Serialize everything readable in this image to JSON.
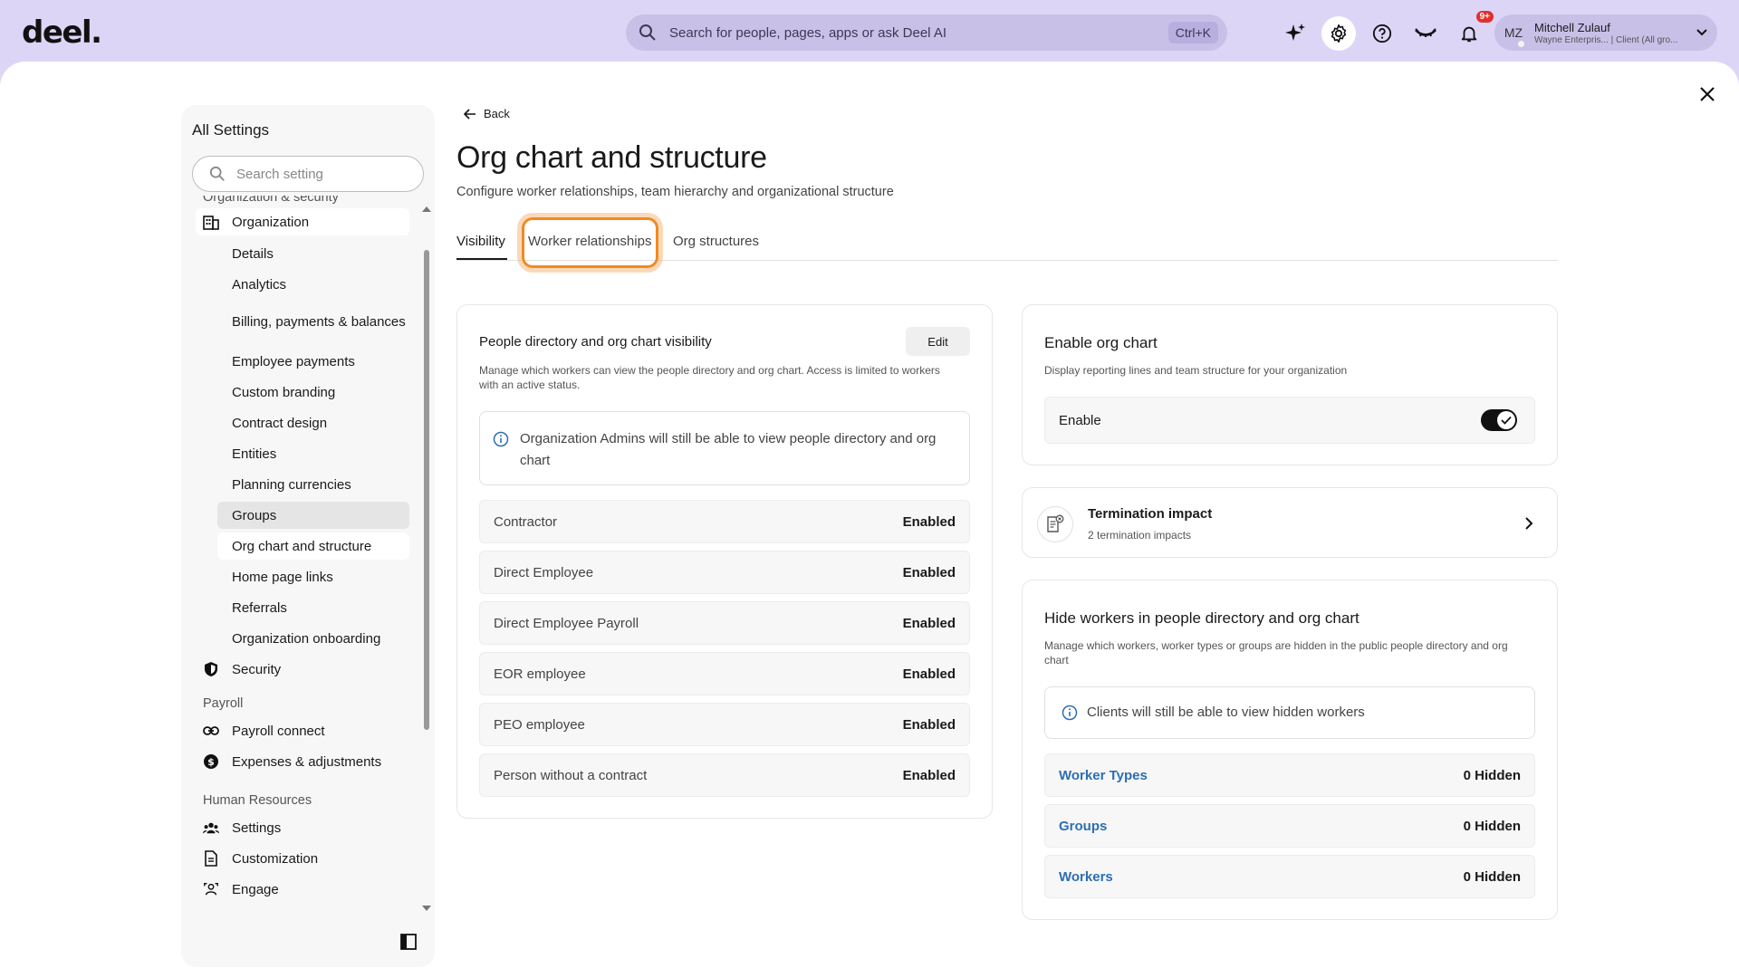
{
  "topbar": {
    "logo": "deel.",
    "search_placeholder": "Search for people, pages, apps or ask Deel AI",
    "search_shortcut": "Ctrl+K",
    "notifications_badge": "9+",
    "user": {
      "initials": "MZ",
      "name": "Mitchell Zulauf",
      "subtitle": "Wayne Enterpris... | Client (All gro..."
    }
  },
  "sidebar": {
    "title": "All Settings",
    "search_placeholder": "Search setting",
    "sections": {
      "org_security": "Organization & security",
      "payroll": "Payroll",
      "hr": "Human Resources"
    },
    "organization": "Organization",
    "org_items": [
      "Details",
      "Analytics",
      "Billing, payments & balances",
      "Employee payments",
      "Custom branding",
      "Contract design",
      "Entities",
      "Planning currencies",
      "Groups",
      "Org chart and structure",
      "Home page links",
      "Referrals",
      "Organization onboarding"
    ],
    "security": "Security",
    "payroll_items": [
      "Payroll connect",
      "Expenses & adjustments"
    ],
    "hr_items": [
      "Settings",
      "Customization",
      "Engage"
    ]
  },
  "content": {
    "back": "Back",
    "title": "Org chart and structure",
    "subtitle": "Configure worker relationships, team hierarchy and organizational structure",
    "tabs": [
      "Visibility",
      "Worker relationships",
      "Org structures"
    ],
    "visibility_card": {
      "title": "People directory and org chart visibility",
      "edit": "Edit",
      "desc": "Manage which workers can view the people directory and org chart. Access is limited to workers with an active status.",
      "info": "Organization Admins will still be able to view people directory and org chart",
      "rows": [
        {
          "label": "Contractor",
          "value": "Enabled"
        },
        {
          "label": "Direct Employee",
          "value": "Enabled"
        },
        {
          "label": "Direct Employee Payroll",
          "value": "Enabled"
        },
        {
          "label": "EOR employee",
          "value": "Enabled"
        },
        {
          "label": "PEO employee",
          "value": "Enabled"
        },
        {
          "label": "Person without a contract",
          "value": "Enabled"
        }
      ]
    },
    "enable_card": {
      "title": "Enable org chart",
      "desc": "Display reporting lines and team structure for your organization",
      "toggle_label": "Enable"
    },
    "termination": {
      "title": "Termination impact",
      "sub": "2 termination impacts"
    },
    "hide_card": {
      "title": "Hide workers in people directory and org chart",
      "desc": "Manage which workers, worker types or groups are hidden in the public people directory and org chart",
      "info": "Clients will still be able to view hidden workers",
      "rows": [
        {
          "label": "Worker Types",
          "value": "0 Hidden"
        },
        {
          "label": "Groups",
          "value": "0 Hidden"
        },
        {
          "label": "Workers",
          "value": "0 Hidden"
        }
      ]
    }
  },
  "colors": {
    "topbar_bg": "#ddd5f6",
    "link_blue": "#2c6fb2",
    "focus_orange": "#f08a24",
    "badge_red": "#e0312b"
  }
}
